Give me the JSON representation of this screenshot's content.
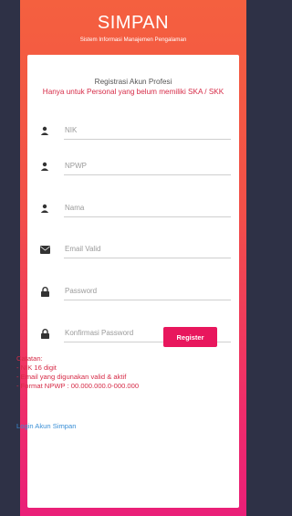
{
  "header": {
    "title": "SIMPAN",
    "subtitle": "Sistem Informasi Manajemen Pengalaman"
  },
  "form": {
    "heading_line1": "Registrasi Akun Profesi",
    "heading_line2": "Hanya untuk Personal yang belum memiliki SKA / SKK",
    "fields": [
      {
        "placeholder": "NIK",
        "icon": "user-icon",
        "value": ""
      },
      {
        "placeholder": "NPWP",
        "icon": "user-icon",
        "value": ""
      },
      {
        "placeholder": "Nama",
        "icon": "user-icon",
        "value": ""
      },
      {
        "placeholder": "Email Valid",
        "icon": "envelope-icon",
        "value": ""
      },
      {
        "placeholder": "Password",
        "icon": "lock-icon",
        "value": ""
      },
      {
        "placeholder": "Konfirmasi Password",
        "icon": "lock-icon",
        "value": ""
      }
    ],
    "register_label": "Register"
  },
  "notes": {
    "title": "Catatan:",
    "lines": [
      "- NIK 16 digit",
      "- Email yang digunakan valid & aktif",
      "- Format NPWP : 00.000.000.0-000.000"
    ]
  },
  "login_link": "Login Akun Simpan",
  "colors": {
    "accent": "#e8175d",
    "note_text": "#d62b47",
    "link": "#3a8fd6",
    "background": "#2e3146"
  }
}
